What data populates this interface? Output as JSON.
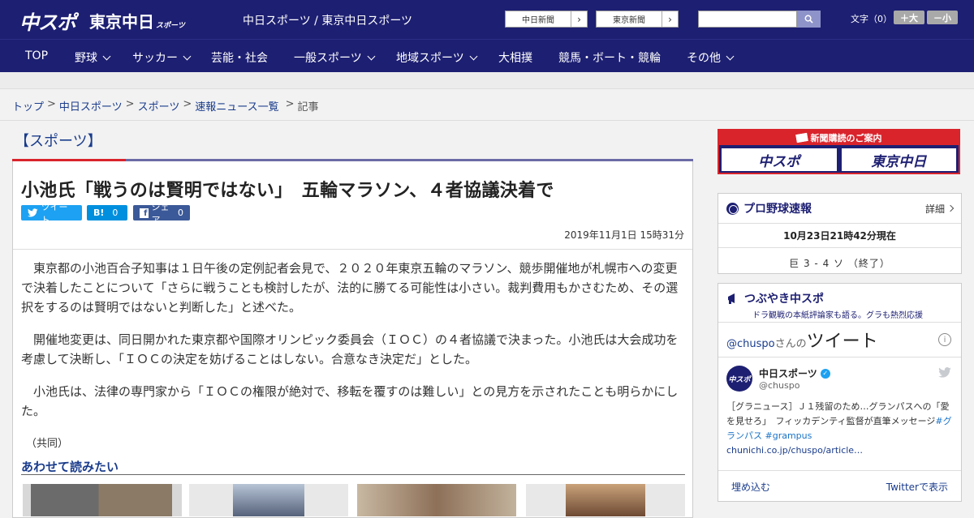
{
  "header": {
    "logo_primary": "中スポ",
    "logo_secondary": "東京中日",
    "logo_secondary_sub": "スポーツ",
    "tagline": "中日スポーツ / 東京中日スポーツ",
    "ext_links": [
      {
        "label": "中日新聞",
        "arrow": "›"
      },
      {
        "label": "東京新聞",
        "arrow": "›"
      }
    ],
    "search": {
      "placeholder": ""
    },
    "font_size_label": "文字（0）",
    "font_larger": "＋大",
    "font_smaller": "－小"
  },
  "nav": {
    "items": [
      {
        "label": "TOP",
        "dropdown": false
      },
      {
        "label": "野球",
        "dropdown": true
      },
      {
        "label": "サッカー",
        "dropdown": true
      },
      {
        "label": "芸能・社会",
        "dropdown": false
      },
      {
        "label": "一般スポーツ",
        "dropdown": true
      },
      {
        "label": "地域スポーツ",
        "dropdown": true
      },
      {
        "label": "大相撲",
        "dropdown": false
      },
      {
        "label": "競馬・ボート・競輪",
        "dropdown": false
      },
      {
        "label": "その他",
        "dropdown": true
      }
    ]
  },
  "breadcrumb": {
    "items": [
      "トップ",
      "中日スポーツ",
      "スポーツ",
      "速報ニュース一覧"
    ],
    "current": "記事",
    "separator": ">"
  },
  "article": {
    "category": "【スポーツ】",
    "headline": "小池氏「戦うのは賢明ではない」　五輪マラソン、４者協議決着で",
    "share": {
      "tweet": "ツイート",
      "hatena_label": "B!",
      "hatena_count": "0",
      "facebook": "シェア",
      "facebook_count": "0"
    },
    "date": "2019年11月1日 15時31分",
    "paragraphs": [
      "東京都の小池百合子知事は１日午後の定例記者会見で、２０２０年東京五輪のマラソン、競歩開催地が札幌市への変更で決着したことについて「さらに戦うことも検討したが、法的に勝てる可能性は小さい。裁判費用もかさむため、その選択をするのは賢明ではないと判断した」と述べた。",
      "開催地変更は、同日開かれた東京都や国際オリンピック委員会（ＩＯＣ）の４者協議で決まった。小池氏は大会成功を考慮して決断し、「ＩＯＣの決定を妨げることはしない。合意なき決定だ」とした。",
      "小池氏は、法律の専門家から「ＩＯＣの権限が絶対で、移転を覆すのは難しい」との見方を示されたことも明らかにした。"
    ],
    "credit": "（共同）",
    "related_title": "あわせて読みたい"
  },
  "sidebar": {
    "subscribe": {
      "title": "新聞購読のご案内",
      "logo_left": "中スポ",
      "logo_right": "東京中日"
    },
    "baseball": {
      "title": "プロ野球速報",
      "more": "詳細",
      "time": "10月23日21時42分現在",
      "score": "巨 3 - 4 ソ （終了）"
    },
    "tsubuyaki": {
      "title": "つぶやき中スポ",
      "subtitle": "ドラ観戦の本紙評論家も語る。グラも熱烈応援",
      "handle": "@chuspo",
      "handle_suffix": "さんの",
      "tweets_label": "ツイート",
      "account_name": "中日スポーツ",
      "account_handle": "@chuspo",
      "avatar_text": "中スポ",
      "tweet_text": "［グラニュース］Ｊ１残留のため…グランパスへの「愛を見せろ」　フィッカデンティ監督が直筆メッセージ",
      "tweet_tags": "#グランパス #grampus",
      "tweet_link": "chunichi.co.jp/chuspo/article…",
      "embed": "埋め込む",
      "view_on_twitter": "Twitterで表示"
    }
  },
  "colors": {
    "brand_navy": "#1d1f72",
    "accent_red": "#d9242c",
    "link_blue": "#1a3c8c",
    "twitter_blue": "#1da1f2",
    "hatena_blue": "#008fde",
    "facebook_blue": "#3b5998"
  }
}
